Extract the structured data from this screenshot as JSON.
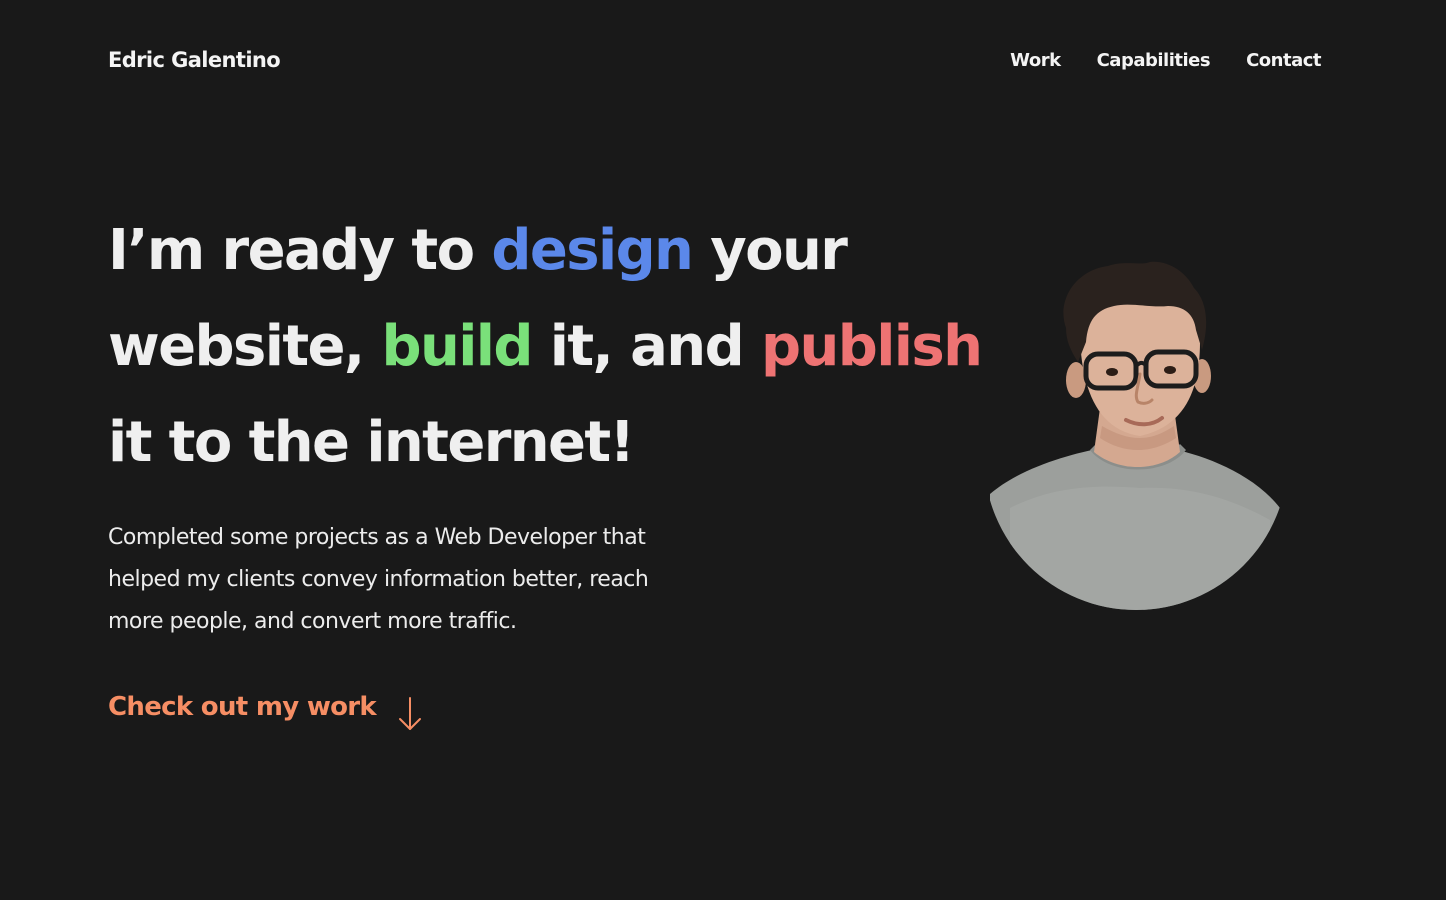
{
  "header": {
    "brand": "Edric Galentino",
    "nav": [
      {
        "label": "Work"
      },
      {
        "label": "Capabilities"
      },
      {
        "label": "Contact"
      }
    ]
  },
  "hero": {
    "headline": {
      "part1": "I’m ready to ",
      "design": "design",
      "part2": " your website, ",
      "build": "build",
      "part3": " it, and ",
      "publish": "publish",
      "part4": " it to the internet!"
    },
    "intro": "Completed some projects as a Web Developer that helped my clients convey information better, reach more people, and convert more traffic.",
    "cta": {
      "label": "Check out my work",
      "icon": "arrow-down-icon"
    },
    "portrait": {
      "icon": "profile-photo"
    }
  },
  "colors": {
    "background": "#191919",
    "text": "#f2f2f2",
    "design": "#5b88ea",
    "build": "#7ae07a",
    "publish": "#ee7373",
    "cta": "#f68e64"
  }
}
